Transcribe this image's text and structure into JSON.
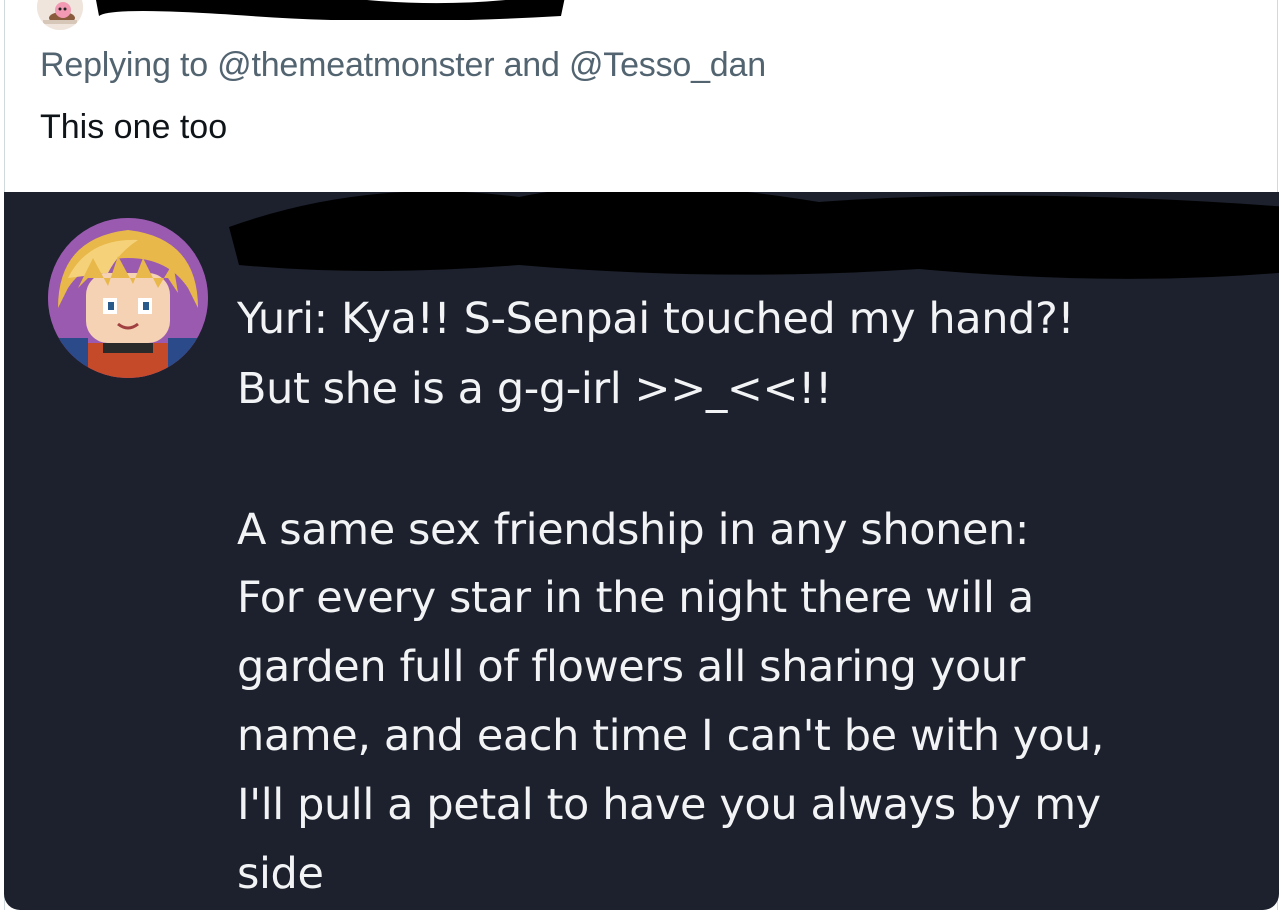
{
  "tweet": {
    "reply_prefix": "Replying to ",
    "mention_1": "@themeatmonster",
    "reply_joiner": " and ",
    "mention_2": "@Tesso_dan",
    "text": "This one too"
  },
  "media": {
    "lines": [
      "Yuri: Kya!! S-Senpai touched my hand?!",
      "But she is a g-g-irl >>_<<!!",
      "A same sex friendship in any shonen:",
      "For every star in the night there will a",
      "garden full of flowers all sharing your",
      "name, and each time I can't be with you,",
      "I'll pull a petal to have you always by my",
      "side"
    ]
  },
  "colors": {
    "reply_context": "#536471",
    "tweet_text": "#0f1419",
    "media_background": "#1d212d",
    "media_text": "#f2f3f5"
  },
  "icons": {
    "author_avatar": "pixel-art-avatar-icon",
    "quoted_avatar": "pixel-art-blonde-character-avatar-icon"
  }
}
